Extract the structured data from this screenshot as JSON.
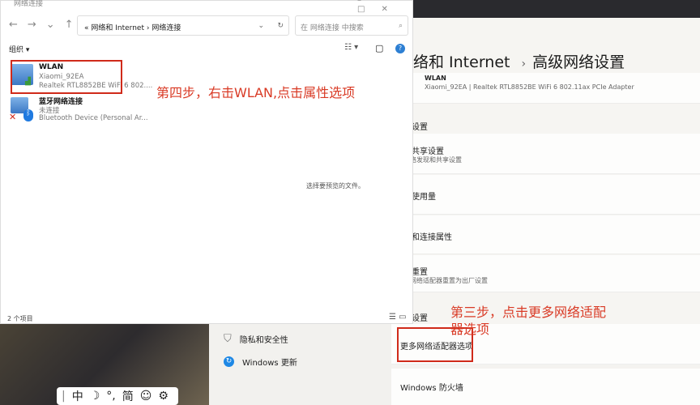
{
  "explorer": {
    "title": "网络连接",
    "address": {
      "parent": "网络和 Internet",
      "current": "网络连接"
    },
    "search_placeholder": "在 网络连接 中搜索",
    "organize": "组织 ▾",
    "items": [
      {
        "name": "WLAN",
        "status": "Xiaomi_92EA",
        "device": "Realtek RTL8852BE WiFi 6 802...."
      },
      {
        "name": "蓝牙网络连接",
        "status": "未连接",
        "device": "Bluetooth Device (Personal Ar..."
      }
    ],
    "preview_hint": "选择要预览的文件。",
    "status_count": "2 个项目"
  },
  "annotations": {
    "step4": "第四步，右击WLAN,点击属性选项",
    "step3_line1": "第三步，点击更多网络适配",
    "step3_line2": "器选项"
  },
  "settings": {
    "breadcrumb_parent": "络和 Internet",
    "breadcrumb_sep": "›",
    "title": "高级网络设置",
    "wlan_card": {
      "name": "WLAN",
      "detail": "Xiaomi_92EA | Realtek RTL8852BE WiFi 6 802.11ax PCIe Adapter"
    },
    "section1": "设置",
    "cards": [
      {
        "title": "级共享设置",
        "sub": "网络发现和共享设置"
      },
      {
        "title": "络使用量",
        "sub": ""
      },
      {
        "title": "件和连接属性",
        "sub": ""
      },
      {
        "title": "络重置",
        "sub": "有网络适配器重置为出厂设置"
      }
    ],
    "section2": "设置",
    "more_adapters": "更多网络适配器选项",
    "firewall": "Windows 防火墙"
  },
  "sidebar": [
    {
      "label": "隐私和安全性",
      "icon": "shield-icon"
    },
    {
      "label": "Windows 更新",
      "icon": "update-icon"
    }
  ],
  "ime": {
    "items": [
      "中",
      "☽",
      "°,",
      "简",
      "☺",
      "⚙"
    ]
  }
}
